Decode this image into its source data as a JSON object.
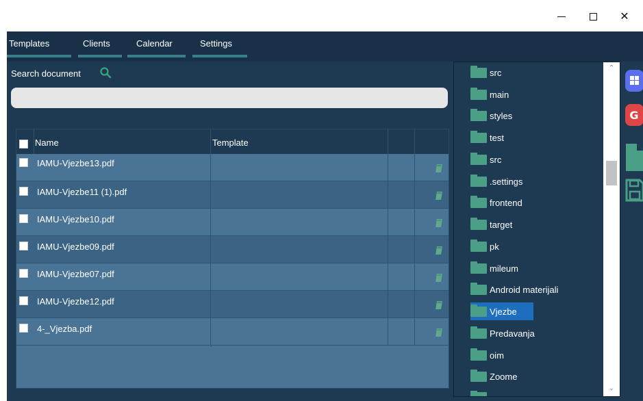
{
  "window": {
    "minimize_icon": "minimize-icon",
    "maximize_icon": "maximize-icon",
    "close_label": "✕"
  },
  "nav": {
    "tabs": [
      "Templates",
      "Clients",
      "Calendar",
      "Settings"
    ]
  },
  "search": {
    "label": "Search document",
    "value": "",
    "placeholder": ""
  },
  "table": {
    "columns": [
      "Name",
      "Template",
      "",
      ""
    ],
    "rows": [
      {
        "name": "IAMU-Vjezbe13.pdf",
        "template": ""
      },
      {
        "name": "IAMU-Vjezbe11 (1).pdf",
        "template": ""
      },
      {
        "name": "IAMU-Vjezbe10.pdf",
        "template": ""
      },
      {
        "name": "IAMU-Vjezbe09.pdf",
        "template": ""
      },
      {
        "name": "IAMU-Vjezbe07.pdf",
        "template": ""
      },
      {
        "name": "IAMU-Vjezbe12.pdf",
        "template": ""
      },
      {
        "name": "4-_Vjezba.pdf",
        "template": ""
      }
    ]
  },
  "tree": {
    "items": [
      "src",
      "main",
      "styles",
      "test",
      "src",
      ".settings",
      "frontend",
      "target",
      "pk",
      "mileum",
      "Android materijali",
      "Vjezbe",
      "Predavanja",
      "oim",
      "Zoome"
    ],
    "selected": "Vjezbe"
  },
  "side_icons": [
    "windows-icon",
    "google-icon",
    "new-file-icon",
    "save-icon"
  ],
  "colors": {
    "background": "#1d3a52",
    "nav": "#183148",
    "accent_teal": "#3b7f86",
    "folder": "#4c9f87",
    "row_light": "#4a7496",
    "row_dark": "#3a6384",
    "selection": "#1e6ec0",
    "windows_badge": "#5b6ef0",
    "google_badge": "#e04545"
  }
}
